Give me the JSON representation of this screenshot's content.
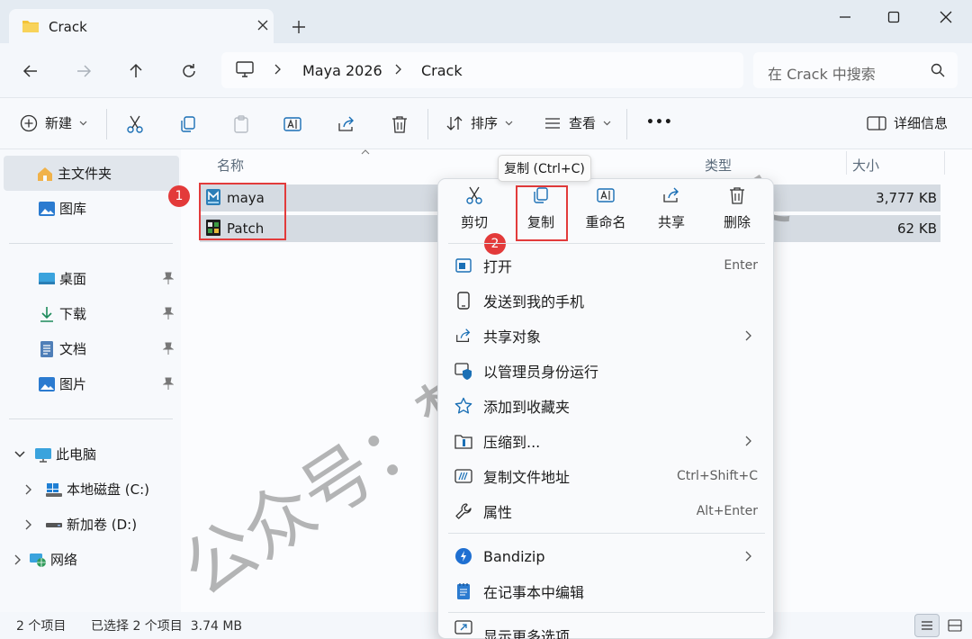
{
  "window": {
    "tab_title": "Crack",
    "new_tab": "+",
    "minimize": "minimize",
    "maximize": "maximize",
    "close": "close"
  },
  "nav": {
    "breadcrumb": [
      "Maya 2026",
      "Crack"
    ],
    "search_placeholder": "在 Crack 中搜索"
  },
  "toolbar": {
    "new_label": "新建",
    "sort_label": "排序",
    "view_label": "查看",
    "more_label": "•••",
    "details_label": "详细信息"
  },
  "sidebar": {
    "home": "主文件夹",
    "gallery": "图库",
    "desktop": "桌面",
    "downloads": "下载",
    "documents": "文档",
    "pictures": "图片",
    "this_pc": "此电脑",
    "drive_c": "本地磁盘 (C:)",
    "drive_d": "新加卷 (D:)",
    "network": "网络"
  },
  "columns": {
    "name": "名称",
    "type": "类型",
    "size": "大小"
  },
  "files": [
    {
      "name": "maya",
      "size": "3,777 KB"
    },
    {
      "name": "Patch",
      "size": "62 KB"
    }
  ],
  "badges": {
    "one": "1",
    "two": "2"
  },
  "tooltip": "复制 (Ctrl+C)",
  "context_menu": {
    "quick_actions": {
      "cut": "剪切",
      "copy": "复制",
      "rename": "重命名",
      "share": "共享",
      "delete": "删除"
    },
    "items": [
      {
        "label": "打开",
        "shortcut": "Enter"
      },
      {
        "label": "发送到我的手机",
        "shortcut": ""
      },
      {
        "label": "共享对象",
        "shortcut": ""
      },
      {
        "label": "以管理员身份运行",
        "shortcut": ""
      },
      {
        "label": "添加到收藏夹",
        "shortcut": ""
      },
      {
        "label": "压缩到...",
        "shortcut": ""
      },
      {
        "label": "复制文件地址",
        "shortcut": "Ctrl+Shift+C"
      },
      {
        "label": "属性",
        "shortcut": "Alt+Enter"
      },
      {
        "label": "Bandizip",
        "shortcut": ""
      },
      {
        "label": "在记事本中编辑",
        "shortcut": ""
      },
      {
        "label": "显示更多选项",
        "shortcut": ""
      }
    ]
  },
  "status": {
    "count": "2 个项目",
    "selected": "已选择 2 个项目  3.74 MB"
  },
  "watermark": "公众号：梵梦软件管家",
  "colors": {
    "accent": "#0f6cbd",
    "highlight_red": "#e23b3b",
    "selection": "#d5dbe2"
  }
}
